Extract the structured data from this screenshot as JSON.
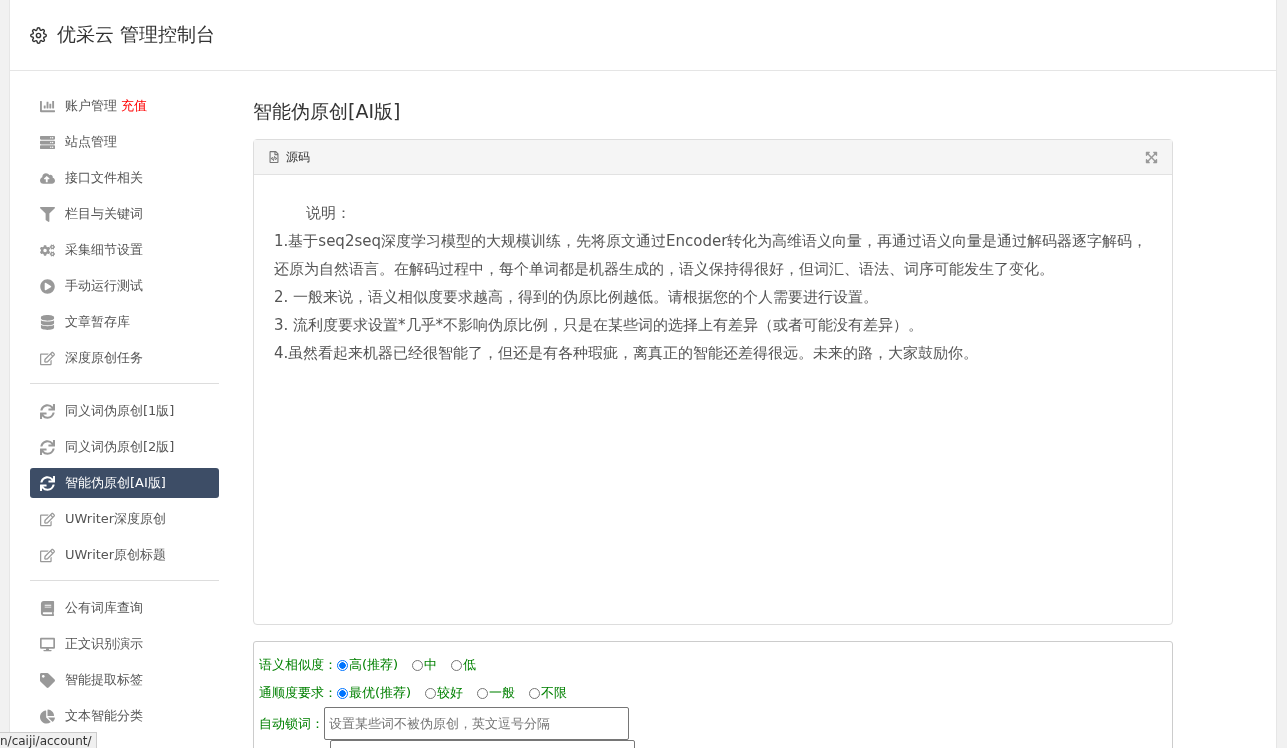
{
  "header": {
    "title": "优采云 管理控制台"
  },
  "sidebar": {
    "groups": [
      {
        "items": [
          {
            "label": "账户管理",
            "badge": "充值",
            "selected": false
          },
          {
            "label": "站点管理",
            "selected": false
          },
          {
            "label": "接口文件相关",
            "selected": false
          },
          {
            "label": "栏目与关键词",
            "selected": false
          },
          {
            "label": "采集细节设置",
            "selected": false
          },
          {
            "label": "手动运行测试",
            "selected": false
          },
          {
            "label": "文章暂存库",
            "selected": false
          },
          {
            "label": "深度原创任务",
            "selected": false
          }
        ]
      },
      {
        "items": [
          {
            "label": "同义词伪原创[1版]",
            "selected": false
          },
          {
            "label": "同义词伪原创[2版]",
            "selected": false
          },
          {
            "label": "智能伪原创[AI版]",
            "selected": true
          },
          {
            "label": "UWriter深度原创",
            "selected": false
          },
          {
            "label": "UWriter原创标题",
            "selected": false
          }
        ]
      },
      {
        "items": [
          {
            "label": "公有词库查询",
            "selected": false
          },
          {
            "label": "正文识别演示",
            "selected": false
          },
          {
            "label": "智能提取标签",
            "selected": false
          },
          {
            "label": "文本智能分类",
            "selected": false
          }
        ]
      }
    ]
  },
  "page_title": "智能伪原创[AI版]",
  "panel": {
    "title": "源码",
    "intro": "说明：",
    "paragraphs": [
      "1.基于seq2seq深度学习模型的大规模训练，先将原文通过Encoder转化为高维语义向量，再通过语义向量是通过解码器逐字解码，还原为自然语言。在解码过程中，每个单词都是机器生成的，语义保持得很好，但词汇、语法、词序可能发生了变化。",
      "2. 一般来说，语义相似度要求越高，得到的伪原比例越低。请根据您的个人需要进行设置。",
      "3. 流利度要求设置*几乎*不影响伪原比例，只是在某些词的选择上有差异（或者可能没有差异）。",
      "4.虽然看起来机器已经很智能了，但还是有各种瑕疵，离真正的智能还差得很远。未来的路，大家鼓励你。"
    ]
  },
  "form": {
    "rows": [
      {
        "kind": "radio",
        "label": "语义相似度：",
        "options": [
          {
            "label": "高(推荐)",
            "selected": true
          },
          {
            "label": "中",
            "selected": false
          },
          {
            "label": "低",
            "selected": false
          }
        ]
      },
      {
        "kind": "radio",
        "label": "通顺度要求：",
        "options": [
          {
            "label": "最优(推荐)",
            "selected": true
          },
          {
            "label": "较好",
            "selected": false
          },
          {
            "label": "一般",
            "selected": false
          },
          {
            "label": "不限",
            "selected": false
          }
        ]
      },
      {
        "kind": "text",
        "label": "自动锁词：",
        "placeholder": "设置某些词不被伪原创，英文逗号分隔"
      },
      {
        "kind": "text"
      }
    ]
  },
  "status_bar": {
    "url": "n/caiji/account/"
  }
}
